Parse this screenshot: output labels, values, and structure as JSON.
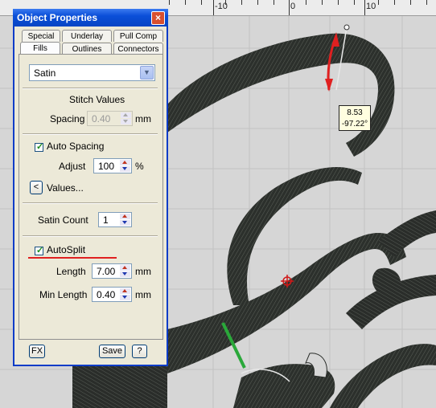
{
  "ruler": {
    "labels": [
      "-10",
      "0",
      "10"
    ]
  },
  "tooltip": {
    "line1": "8.53",
    "line2": "-97.22°"
  },
  "dialog": {
    "title": "Object Properties",
    "close_glyph": "×",
    "tabs": [
      "Special",
      "Underlay",
      "Pull Comp",
      "Fills",
      "Outlines",
      "Connectors"
    ],
    "fill_type": "Satin",
    "dropdown_glyph": "▼",
    "stitch_values_heading": "Stitch Values",
    "spacing_label": "Spacing",
    "spacing_value": "0.40",
    "spacing_unit": "mm",
    "auto_spacing_label": "Auto Spacing",
    "auto_spacing_checked": true,
    "adjust_label": "Adjust",
    "adjust_value": "100",
    "adjust_unit": "%",
    "values_glyph": "<",
    "values_label": "Values...",
    "satin_count_label": "Satin Count",
    "satin_count_value": "1",
    "autosplit_label": "AutoSplit",
    "autosplit_checked": true,
    "length_label": "Length",
    "length_value": "7.00",
    "length_unit": "mm",
    "min_length_label": "Min Length",
    "min_length_value": "0.40",
    "min_length_unit": "mm",
    "fx_label": "FX",
    "save_label": "Save",
    "help_label": "?"
  },
  "colors": {
    "accent_blue": "#0a4fd8",
    "annotation_red": "#e02020",
    "stitch_dark": "#2c302c",
    "green_marker": "#2aa83a"
  }
}
